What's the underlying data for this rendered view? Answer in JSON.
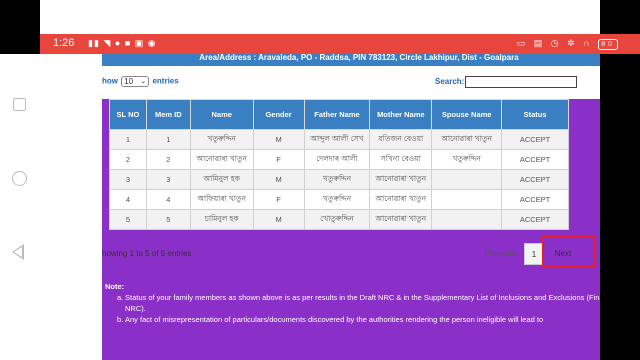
{
  "status_bar": {
    "time": "1:26",
    "left_icons": [
      "signal-icon",
      "signal-icon",
      "wifi-icon",
      "whatsapp-icon",
      "message-icon",
      "image-icon",
      "app-icon"
    ],
    "battery_level": "80",
    "colors": {
      "background": "#e8453c"
    }
  },
  "banner": {
    "text": "Area/Address : Aravaleda, PO - Raddsa, PIN 783123, Circle Lakhipur, Dist - Goalpara"
  },
  "table_controls": {
    "show_label": "how",
    "entries_value": "10",
    "entries_label": "entries",
    "search_label": "Search:",
    "search_value": ""
  },
  "table": {
    "headers": [
      "SL NO",
      "Mem ID",
      "Name",
      "Gender",
      "Father Name",
      "Mother Name",
      "Spouse Name",
      "Status"
    ],
    "rows": [
      [
        "1",
        "1",
        "খতুৰুদ্দিন",
        "M",
        "আব্দুল আলী সেখ",
        "যতিজন বেওয়া",
        "আনোৱাৰা খাতুন",
        "ACCEPT"
      ],
      [
        "2",
        "2",
        "আনোৱাৰা খাতুন",
        "F",
        "দেলদাৰ আলী",
        "সখিনা বেওয়া",
        "খতুৰুদ্দিন",
        "ACCEPT"
      ],
      [
        "3",
        "3",
        "আমিনুল হক",
        "M",
        "খতুৰুদ্দিন",
        "আনোৱাৰা খাতুন",
        "",
        "ACCEPT"
      ],
      [
        "4",
        "4",
        "আফিয়াৰা খাতুন",
        "F",
        "খতুৰুদ্দিন",
        "আনোৱাৰা খাতুন",
        "",
        "ACCEPT"
      ],
      [
        "5",
        "5",
        "চামিনুল হক",
        "M",
        "খোতুৰুদ্দিন",
        "আনোৱাৰা খাতুন",
        "",
        "ACCEPT"
      ]
    ]
  },
  "info": {
    "text": "howing 1 to 5 of 5 entries"
  },
  "pagination": {
    "previous": "Previous",
    "current_page": "1",
    "next": "Next"
  },
  "note": {
    "title": "Note:",
    "items": [
      {
        "marker": "a.",
        "text": "Status of your family members as shown above is as per results in the Draft NRC & in the Supplementary List of Inclusions and Exclusions (Final NRC)."
      },
      {
        "marker": "b.",
        "text": "Any fact of misrepresentation of particulars/documents discovered by the authorities rendering the person ineligible will lead to"
      }
    ]
  },
  "colors": {
    "table_header": "#3a7fc1",
    "purple": "#8b2fc9",
    "highlight": "#e62020"
  }
}
